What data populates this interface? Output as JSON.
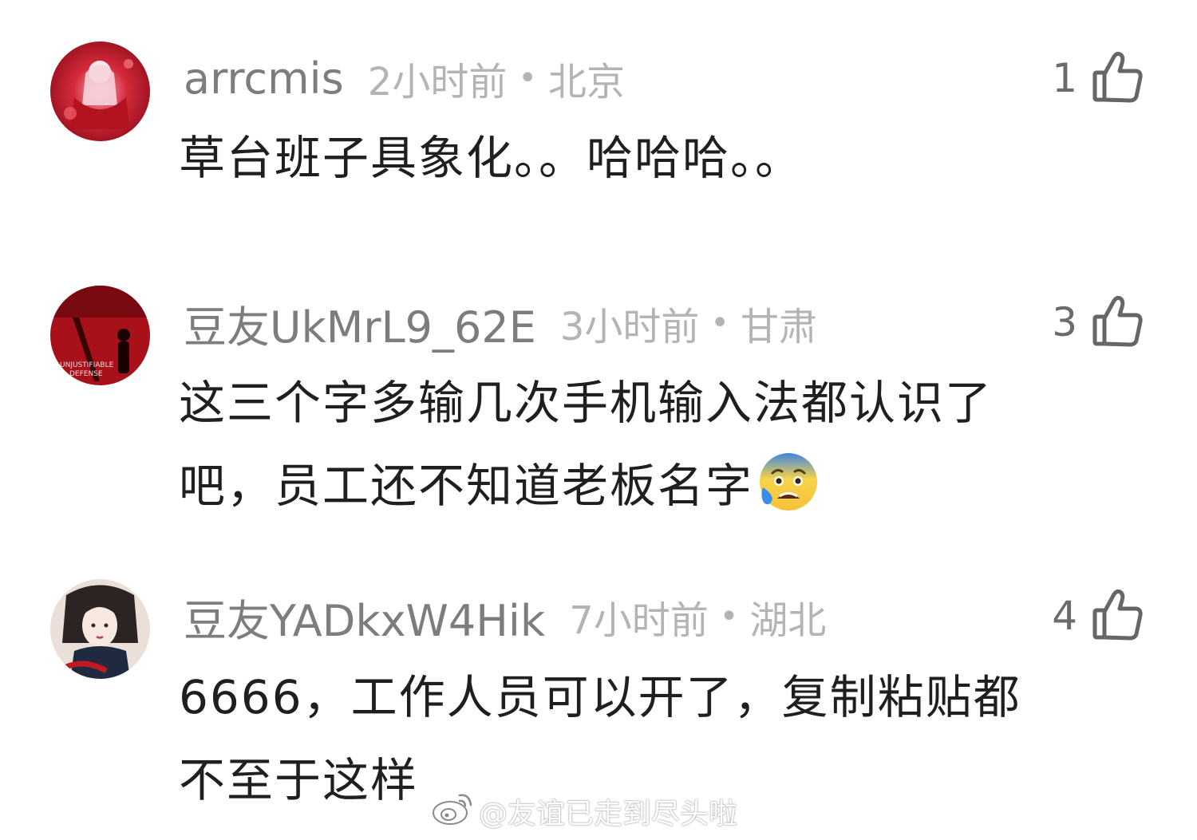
{
  "comments": [
    {
      "username": "arrcmis",
      "time": "2小时前",
      "separator": "•",
      "location": "北京",
      "likes": "1",
      "text": "草台班子具象化。。哈哈哈。。"
    },
    {
      "username": "豆友UkMrL9_62E",
      "time": "3小时前",
      "separator": "•",
      "location": "甘肃",
      "likes": "3",
      "text_line1": "这三个字多输几次手机输入法都认识了",
      "text_line2": "吧，员工还不知道老板名字",
      "avatar_text": "UNJUSTIFIABLE DEFENSE",
      "emoji": "anxious-face-with-sweat"
    },
    {
      "username": "豆友YADkxW4Hik",
      "time": "7小时前",
      "separator": "•",
      "location": "湖北",
      "likes": "4",
      "text_line1": "6666，工作人员可以开了，复制粘贴都",
      "text_line2": "不至于这样"
    }
  ],
  "watermark": {
    "text": "@友谊已走到尽头啦",
    "icon": "weibo-icon"
  },
  "colors": {
    "username": "#7d7d7d",
    "meta": "#b4b4b4",
    "body": "#1f1f1f",
    "like": "#6b6b6b"
  }
}
